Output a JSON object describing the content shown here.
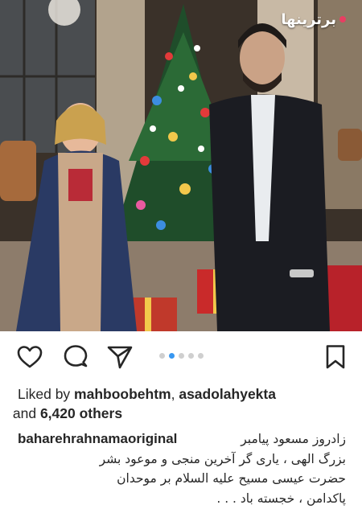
{
  "watermark": {
    "text": "برترینها"
  },
  "post": {
    "photo_description_icon": "photo",
    "carousel": {
      "count": 5,
      "active": 1
    },
    "actions": {
      "like_icon": "heart-icon",
      "comment_icon": "comment-icon",
      "share_icon": "share-icon",
      "save_icon": "bookmark-icon"
    },
    "likes": {
      "prefix": "Liked by ",
      "user1": "mahboobehtm",
      "separator": ", ",
      "user2": "asadolahyekta",
      "and": " and ",
      "others": "6,420 others"
    },
    "caption": {
      "username": "baharehrahnamaoriginal",
      "line1": "زادروز مسعود پیامبر",
      "line2": "بزرگ الهی ، یاری گر آخرین منجی و موعود بشر",
      "line3": "حضرت عیسی مسیح علیه السلام بر موحدان",
      "line4": "پاکدامن ، خجسته باد . . ."
    }
  },
  "colors": {
    "accent": "#3897f0",
    "text": "#262626",
    "inactive_dot": "#cfcfcf"
  }
}
